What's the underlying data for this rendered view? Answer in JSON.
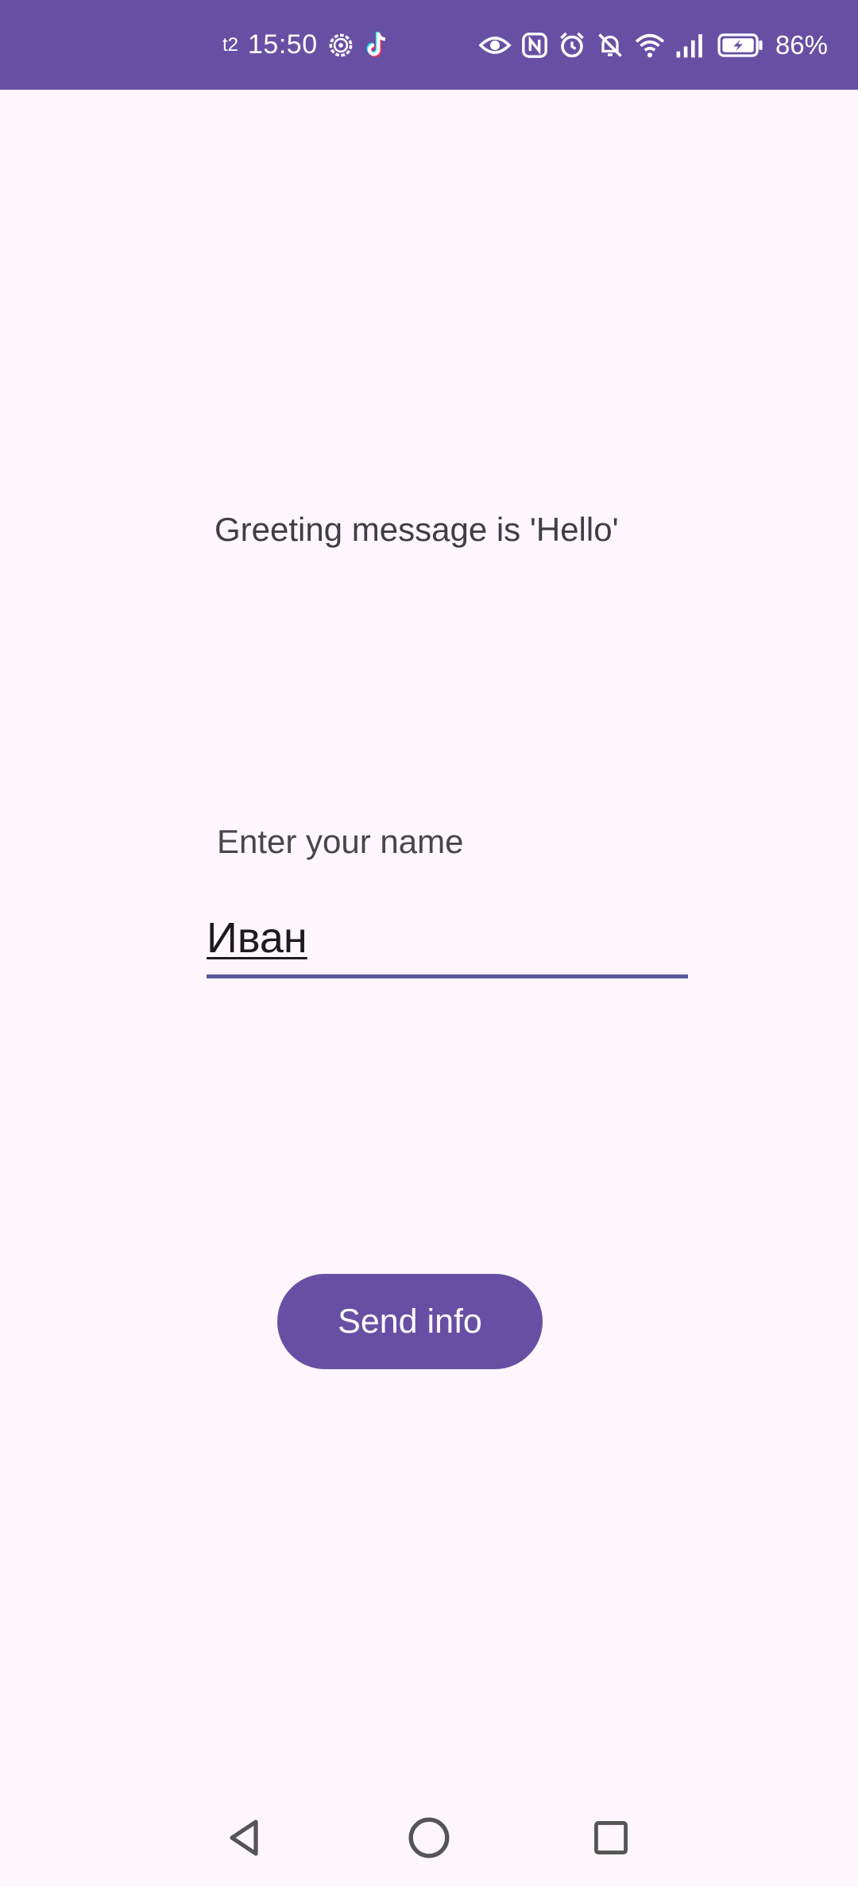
{
  "status_bar": {
    "carrier": "t2",
    "time": "15:50",
    "battery_percent": "86%",
    "left_icons": [
      "settings-icon",
      "tiktok-icon"
    ],
    "right_icons": [
      "eye-icon",
      "nfc-icon",
      "alarm-icon",
      "mute-icon",
      "wifi-icon",
      "signal-icon",
      "battery-charging-icon"
    ],
    "background_color": "#6750A4"
  },
  "main": {
    "greeting_text": "Greeting message is 'Hello'",
    "name_field": {
      "label": "Enter your name",
      "value": "Иван"
    },
    "send_button_label": "Send info",
    "accent_color": "#6750A4"
  },
  "nav_bar": {
    "buttons": [
      "back-icon",
      "home-icon",
      "recents-icon"
    ]
  }
}
